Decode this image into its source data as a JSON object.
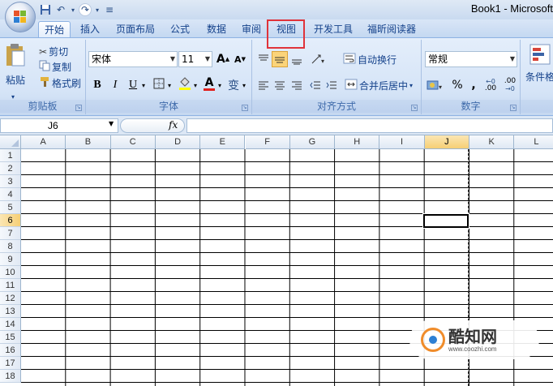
{
  "window": {
    "title": "Book1 - Microsoft"
  },
  "quick_access": {
    "icons": [
      "save-icon",
      "undo-icon",
      "redo-icon",
      "customize-icon"
    ],
    "sep": "≡"
  },
  "tabs": [
    {
      "label": "开始",
      "active": true
    },
    {
      "label": "插入"
    },
    {
      "label": "页面布局"
    },
    {
      "label": "公式"
    },
    {
      "label": "数据"
    },
    {
      "label": "审阅"
    },
    {
      "label": "视图",
      "highlighted": true
    },
    {
      "label": "开发工具"
    },
    {
      "label": "福昕阅读器"
    }
  ],
  "ribbon": {
    "clipboard": {
      "paste": "粘贴",
      "cut": "剪切",
      "copy": "复制",
      "format_painter": "格式刷",
      "label": "剪贴板"
    },
    "font": {
      "name": "宋体",
      "size": "11",
      "grow": "A",
      "shrink": "A",
      "bold": "B",
      "italic": "I",
      "underline": "U",
      "font_color": "A",
      "phonetic": "变",
      "label": "字体"
    },
    "alignment": {
      "wrap": "自动换行",
      "merge": "合并后居中",
      "label": "对齐方式"
    },
    "number": {
      "format": "常规",
      "percent": "%",
      "comma": ",",
      "inc_decimal": ".00",
      "dec_decimal": ".00",
      "label": "数字"
    },
    "styles": {
      "conditional": "条件格"
    }
  },
  "formula_bar": {
    "name_box": "J6",
    "fx": "fx",
    "value": ""
  },
  "sheet": {
    "columns": [
      "A",
      "B",
      "C",
      "D",
      "E",
      "F",
      "G",
      "H",
      "I",
      "J",
      "K",
      "L"
    ],
    "rows": [
      "1",
      "2",
      "3",
      "4",
      "5",
      "6",
      "7",
      "8",
      "9",
      "10",
      "11",
      "12",
      "13",
      "14",
      "15",
      "16",
      "17",
      "18"
    ],
    "selected_column": "J",
    "selected_row": "6"
  },
  "watermark": {
    "name": "酷知网",
    "url": "www.coozhi.com"
  },
  "colors": {
    "accent": "#15428b",
    "highlight_box": "#e0333a",
    "selection": "#f6cf75"
  }
}
